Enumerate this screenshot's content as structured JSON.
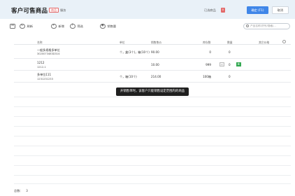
{
  "header": {
    "title": "客户可售商品",
    "tag": "商品",
    "tag_label": "服务",
    "selected_label": "已选商品",
    "selected_count": "0",
    "confirm_label": "确定 (F1)",
    "cancel_label": "取消"
  },
  "toolbar": {
    "items": [
      {
        "icon": "collapse-icon",
        "glyph": "⊟",
        "label": ""
      },
      {
        "icon": "refresh-icon",
        "glyph": "↻",
        "label": "刷新"
      },
      {
        "icon": "add-icon",
        "glyph": "+",
        "label": "新增"
      },
      {
        "icon": "filter-icon",
        "glyph": "?",
        "label": "筛选"
      },
      {
        "icon": "eye-icon",
        "glyph": "◉",
        "label": "销售量"
      }
    ],
    "search_placeholder": "产品名称/货号/规格/..."
  },
  "table": {
    "headers": [
      "名称",
      "单位",
      "销售售价",
      "库存数",
      "数量",
      "其它价格"
    ],
    "rows": [
      {
        "name": "一般多规格多单位",
        "code": "3020073483D314",
        "unit": "个，盒(3个)，箱(10个)",
        "price": "90.00",
        "stock": "0",
        "qty": "0"
      },
      {
        "name": "1212",
        "code": "1212-1",
        "unit": "",
        "price": "10.00",
        "stock": "999",
        "qty": "0"
      },
      {
        "name": "多单位111",
        "code": "1231231233",
        "unit": "个，箱(10个)",
        "price": "214.00",
        "stock": "100箱",
        "qty": "0"
      }
    ]
  },
  "tooltip": "开销售单时，该客户只能销售设定范围内的商品",
  "footer": {
    "total_label": "总数:",
    "total_value": "3"
  }
}
